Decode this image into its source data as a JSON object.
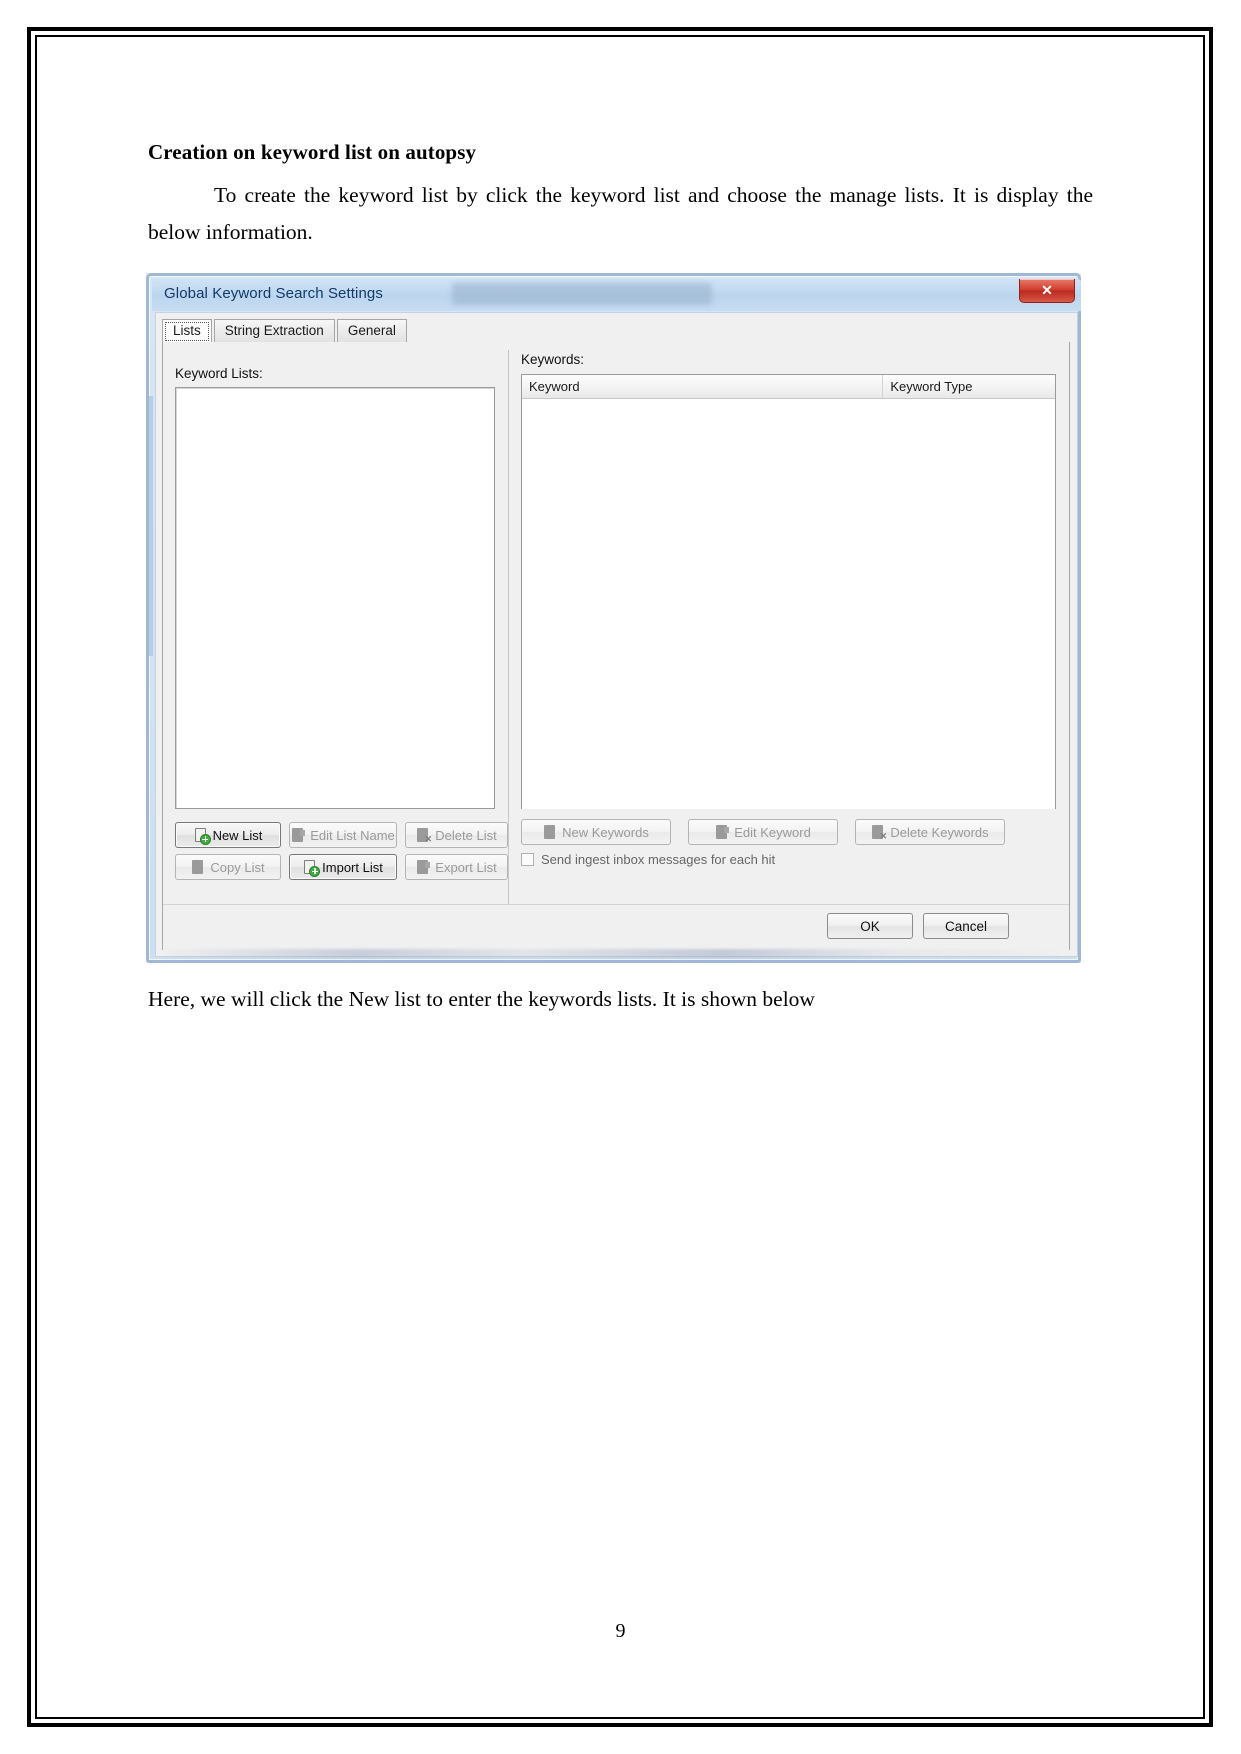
{
  "document": {
    "heading": "Creation on keyword list on autopsy",
    "paragraph_1": "To create the keyword list by click the keyword list and choose the manage lists. It is display the below information.",
    "paragraph_2": "Here, we will click the New list to enter the keywords lists. It is shown below",
    "page_number": "9"
  },
  "dialog": {
    "title": "Global Keyword Search Settings",
    "close_label": "✕",
    "tabs": [
      {
        "label": "Lists",
        "active": true
      },
      {
        "label": "String Extraction",
        "active": false
      },
      {
        "label": "General",
        "active": false
      }
    ],
    "left_panel": {
      "label": "Keyword Lists:",
      "list_items": [],
      "buttons": [
        {
          "label": "New List",
          "enabled": true,
          "icon": "new-list-icon"
        },
        {
          "label": "Edit List Name",
          "enabled": false,
          "icon": "edit-list-icon"
        },
        {
          "label": "Delete List",
          "enabled": false,
          "icon": "delete-list-icon"
        },
        {
          "label": "Copy List",
          "enabled": false,
          "icon": "copy-list-icon"
        },
        {
          "label": "Import List",
          "enabled": true,
          "icon": "import-list-icon"
        },
        {
          "label": "Export List",
          "enabled": false,
          "icon": "export-list-icon"
        }
      ]
    },
    "right_panel": {
      "label": "Keywords:",
      "table": {
        "columns": [
          "Keyword",
          "Keyword Type"
        ],
        "rows": []
      },
      "buttons": [
        {
          "label": "New Keywords",
          "enabled": false,
          "icon": "new-keyword-icon"
        },
        {
          "label": "Edit Keyword",
          "enabled": false,
          "icon": "edit-keyword-icon"
        },
        {
          "label": "Delete Keywords",
          "enabled": false,
          "icon": "delete-keyword-icon"
        }
      ],
      "checkbox": {
        "label": "Send ingest inbox messages for each hit",
        "checked": false
      }
    },
    "footer": {
      "ok_label": "OK",
      "cancel_label": "Cancel"
    },
    "colors": {
      "titlebar": "#c6dcf2",
      "close_button": "#cf3b2c",
      "client_bg": "#f0f0f0",
      "accent_green": "#3fae3f"
    }
  }
}
